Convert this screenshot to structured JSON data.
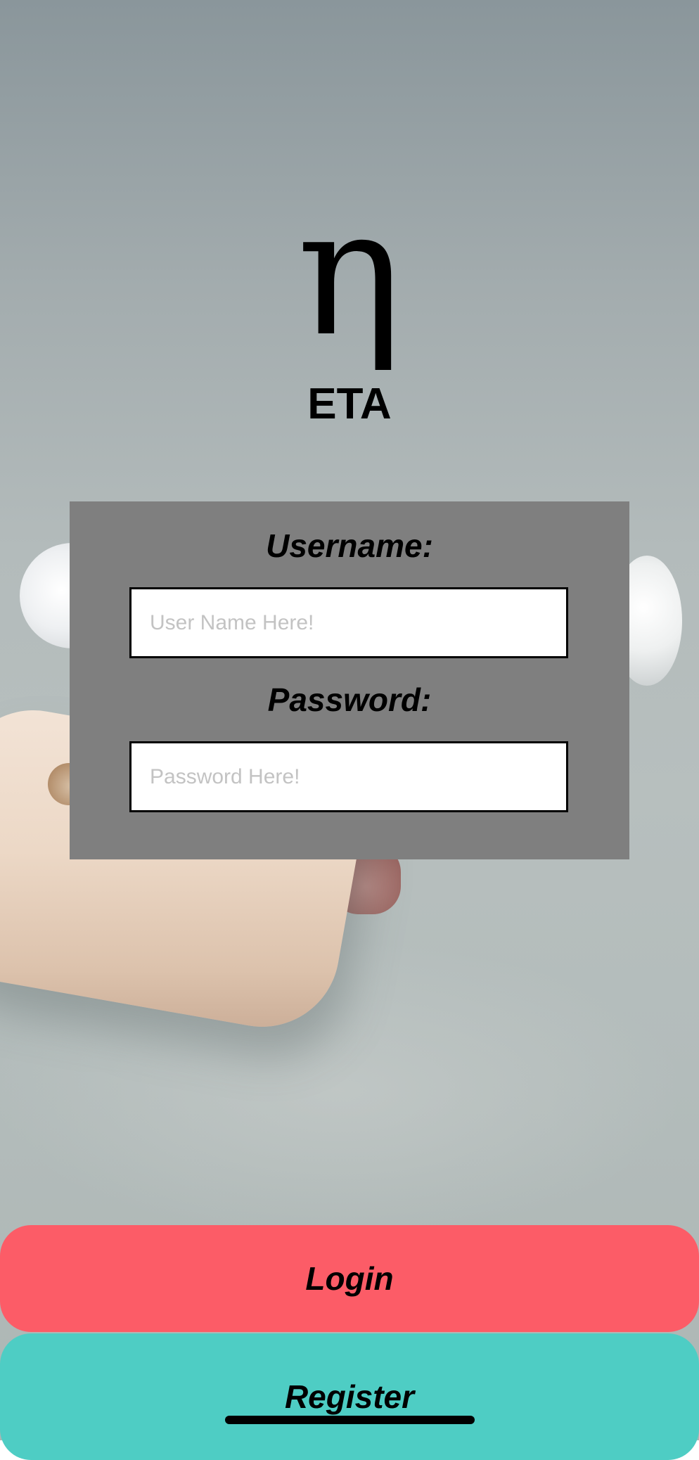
{
  "logo": {
    "symbol": "η",
    "app_name": "ETA"
  },
  "form": {
    "username_label": "Username:",
    "username_value": "",
    "username_placeholder": "User Name Here!",
    "password_label": "Password:",
    "password_value": "",
    "password_placeholder": "Password Here!"
  },
  "actions": {
    "login_label": "Login",
    "register_label": "Register"
  },
  "colors": {
    "panel": "#7f7f7f",
    "login_button": "#fc5c67",
    "register_button": "#4ecdc4"
  }
}
